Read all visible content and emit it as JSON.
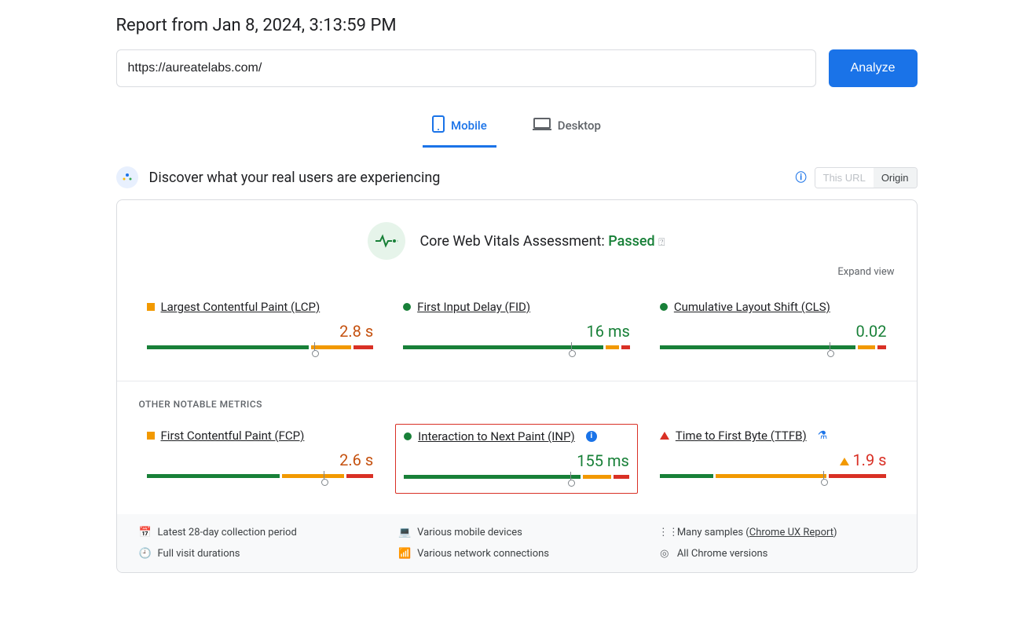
{
  "report_title": "Report from Jan 8, 2024, 3:13:59 PM",
  "url_value": "https://aureatelabs.com/",
  "analyze_label": "Analyze",
  "tabs": {
    "mobile": "Mobile",
    "desktop": "Desktop"
  },
  "discover_title": "Discover what your real users are experiencing",
  "toggle": {
    "this_url": "This URL",
    "origin": "Origin"
  },
  "assessment": {
    "prefix": "Core Web Vitals Assessment: ",
    "status": "Passed"
  },
  "expand_label": "Expand view",
  "metrics": {
    "lcp": {
      "name": "Largest Contentful Paint (LCP)",
      "value": "2.8 s",
      "bar": {
        "g": 73,
        "o": 18,
        "r": 9,
        "marker": 74
      }
    },
    "fid": {
      "name": "First Input Delay (FID)",
      "value": "16 ms",
      "bar": {
        "g": 90,
        "o": 6,
        "r": 4,
        "marker": 74
      }
    },
    "cls": {
      "name": "Cumulative Layout Shift (CLS)",
      "value": "0.02",
      "bar": {
        "g": 88,
        "o": 8,
        "r": 4,
        "marker": 75
      }
    },
    "fcp": {
      "name": "First Contentful Paint (FCP)",
      "value": "2.6 s",
      "bar": {
        "g": 60,
        "o": 28,
        "r": 12,
        "marker": 78
      }
    },
    "inp": {
      "name": "Interaction to Next Paint (INP)",
      "value": "155 ms",
      "bar": {
        "g": 80,
        "o": 13,
        "r": 7,
        "marker": 74
      }
    },
    "ttfb": {
      "name": "Time to First Byte (TTFB)",
      "value": "1.9 s",
      "bar": {
        "g": 24,
        "o": 50,
        "r": 26,
        "marker": 72
      }
    }
  },
  "other_heading": "OTHER NOTABLE METRICS",
  "footer": {
    "period": "Latest 28-day collection period",
    "devices": "Various mobile devices",
    "samples_prefix": "Many samples (",
    "samples_link": "Chrome UX Report",
    "samples_suffix": ")",
    "durations": "Full visit durations",
    "network": "Various network connections",
    "versions": "All Chrome versions"
  },
  "colors": {
    "green": "#188038",
    "orange": "#f29900",
    "red": "#d93025",
    "blue": "#1a73e8"
  }
}
